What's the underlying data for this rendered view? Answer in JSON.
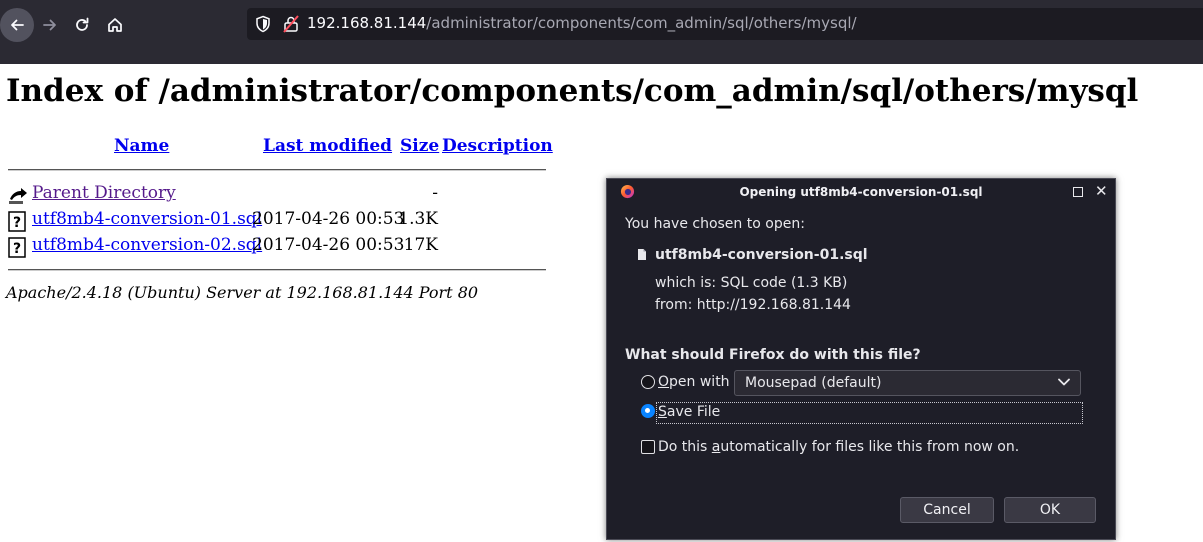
{
  "browser": {
    "url_host": "192.168.81.144",
    "url_path": "/administrator/components/com_admin/sql/others/mysql/",
    "icons": [
      "back-arrow-icon",
      "forward-arrow-icon",
      "reload-icon",
      "home-icon",
      "shield-icon",
      "insecure-lock-icon"
    ],
    "colors": {
      "toolbar": "#2b2a33",
      "urlbar": "#1c1b22"
    }
  },
  "page": {
    "title": "Index of /administrator/components/com_admin/sql/others/mysql",
    "columns": {
      "name": "Name",
      "modified": "Last modified",
      "size": "Size",
      "description": "Description"
    },
    "rows": [
      {
        "name": "Parent Directory",
        "modified": "",
        "size": "-",
        "icon": "back-folder-icon"
      },
      {
        "name": "utf8mb4-conversion-01.sql",
        "modified": "2017-04-26 00:53",
        "size": "1.3K",
        "icon": "file-unknown-icon"
      },
      {
        "name": "utf8mb4-conversion-02.sql",
        "modified": "2017-04-26 00:53",
        "size": "17K",
        "icon": "file-unknown-icon"
      }
    ],
    "signature": "Apache/2.4.18 (Ubuntu) Server at 192.168.81.144 Port 80",
    "colors": {
      "link": "#0000ee",
      "visited": "#551a8b"
    }
  },
  "dialog": {
    "title": "Opening utf8mb4-conversion-01.sql",
    "chosen_text": "You have chosen to open:",
    "file_name": "utf8mb4-conversion-01.sql",
    "which_is": "which is:  SQL code (1.3 KB)",
    "from": "from:  http://192.168.81.144",
    "question": "What should Firefox do with this file?",
    "open_with_prefix": "",
    "open_with_access": "O",
    "open_with_rest": "pen with",
    "open_with_app": "Mousepad (default)",
    "save_access": "S",
    "save_rest": "ave File",
    "selected_option": "Save File",
    "auto_prefix": "Do this ",
    "auto_access": "a",
    "auto_rest": "utomatically for files like this from now on.",
    "auto_checked": false,
    "cancel_label": "Cancel",
    "ok_label": "OK",
    "colors": {
      "background": "#1e1e28",
      "radio_selected": "#0a84ff"
    }
  }
}
